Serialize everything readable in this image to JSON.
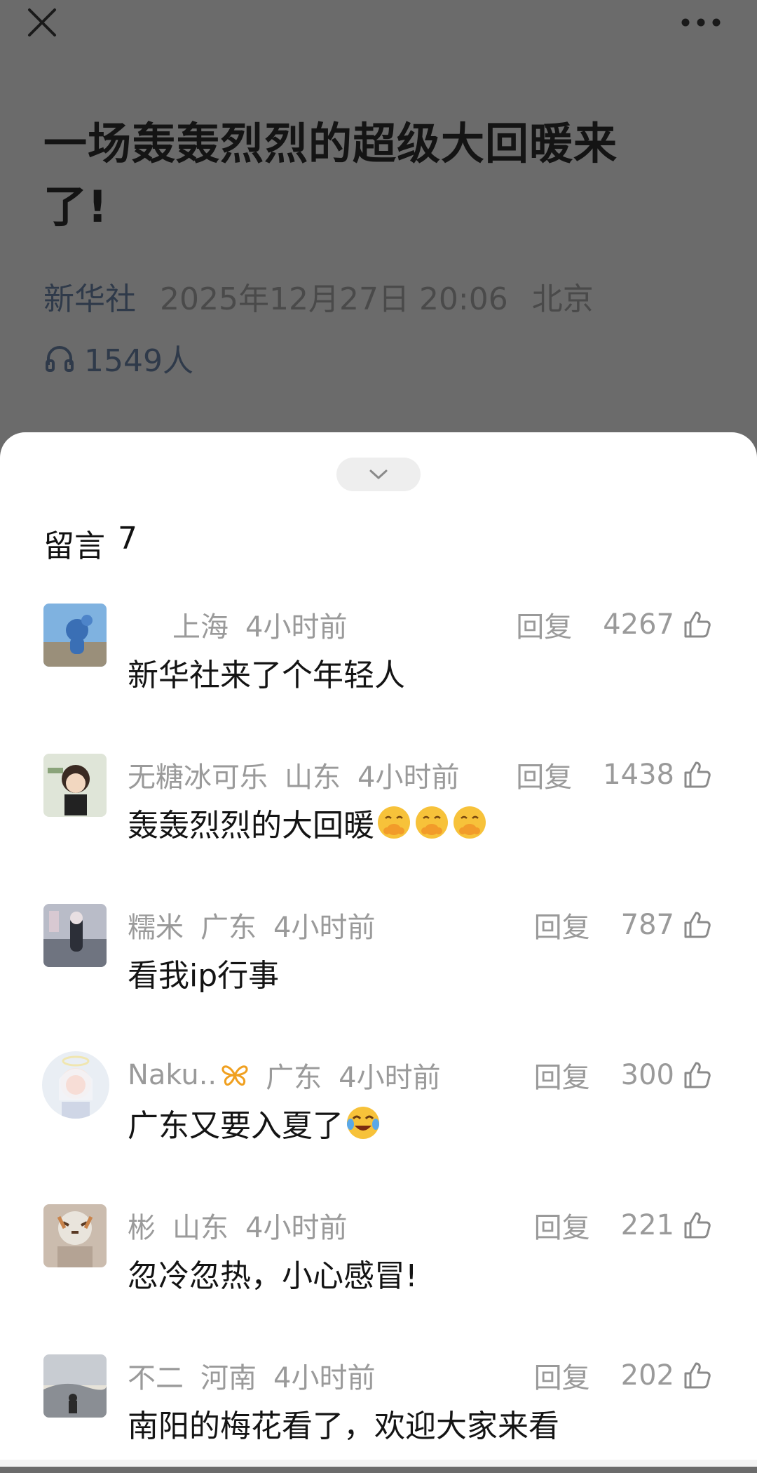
{
  "article": {
    "title": "一场轰轰烈烈的超级大回暖来了!",
    "source": "新华社",
    "datetime": "2025年12月27日 20:06",
    "location": "北京",
    "listeners": "1549人"
  },
  "sheet": {
    "title_label": "留言",
    "count": "7"
  },
  "comments": [
    {
      "name": "",
      "region": "上海",
      "time": "4小时前",
      "reply_label": "回复",
      "likes": "4267",
      "text": "新华社来了个年轻人"
    },
    {
      "name": "无糖冰可乐",
      "region": "山东",
      "time": "4小时前",
      "reply_label": "回复",
      "likes": "1438",
      "text": "轰轰烈烈的大回暖"
    },
    {
      "name": "糯米",
      "region": "广东",
      "time": "4小时前",
      "reply_label": "回复",
      "likes": "787",
      "text": "看我ip行事"
    },
    {
      "name": "Naku..",
      "region": "广东",
      "time": "4小时前",
      "reply_label": "回复",
      "likes": "300",
      "text": "广东又要入夏了"
    },
    {
      "name": "彬",
      "region": "山东",
      "time": "4小时前",
      "reply_label": "回复",
      "likes": "221",
      "text": "忽冷忽热，小心感冒!"
    },
    {
      "name": "不二",
      "region": "河南",
      "time": "4小时前",
      "reply_label": "回复",
      "likes": "202",
      "text": "南阳的梅花看了，欢迎大家来看"
    }
  ],
  "icons": {
    "close": "close-icon",
    "more": "more-dots-icon",
    "headphones": "headphones-icon",
    "collapse": "chevron-down-icon",
    "like": "thumbs-up-icon",
    "emoji_blush": "blushing-face-emoji",
    "emoji_laugh": "tears-of-joy-emoji",
    "butterfly": "butterfly-badge-icon"
  },
  "colors": {
    "dim_overlay": "#6b6b6b",
    "sheet_bg": "#ffffff",
    "meta_gray": "#9a9a9a",
    "text_dark": "#141414"
  }
}
